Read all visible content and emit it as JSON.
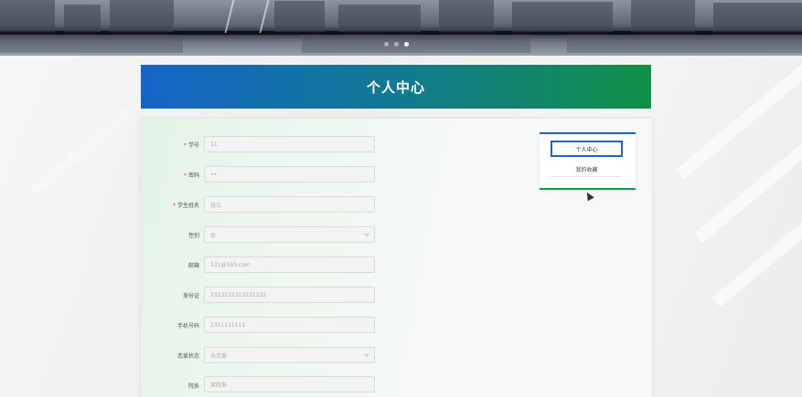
{
  "banner": {
    "icon": "city-skyline-image",
    "slide_count": 3,
    "active_slide": 2
  },
  "page": {
    "title": "个人中心"
  },
  "form": {
    "fields": [
      {
        "label": "学号",
        "required": true,
        "value": "11",
        "type": "text"
      },
      {
        "label": "密码",
        "required": true,
        "value": "••",
        "type": "password"
      },
      {
        "label": "学生姓名",
        "required": true,
        "value": "张三",
        "type": "text"
      },
      {
        "label": "性别",
        "required": false,
        "value": "女",
        "type": "select"
      },
      {
        "label": "邮箱",
        "required": false,
        "value": "131@163.com",
        "type": "text"
      },
      {
        "label": "身份证",
        "required": false,
        "value": "2323232323232232",
        "type": "text"
      },
      {
        "label": "手机号码",
        "required": false,
        "value": "1311111111",
        "type": "text"
      },
      {
        "label": "恋爱状态",
        "required": false,
        "value": "未恋爱",
        "type": "select"
      },
      {
        "label": "院系",
        "required": false,
        "value": "某院系",
        "type": "text"
      }
    ]
  },
  "side_menu": {
    "items": [
      {
        "label": "个人中心",
        "active": true
      },
      {
        "label": "我的收藏",
        "active": false
      }
    ]
  },
  "colors": {
    "accent_blue": "#1e63c4",
    "accent_green": "#139447",
    "required": "#e24b4b"
  }
}
